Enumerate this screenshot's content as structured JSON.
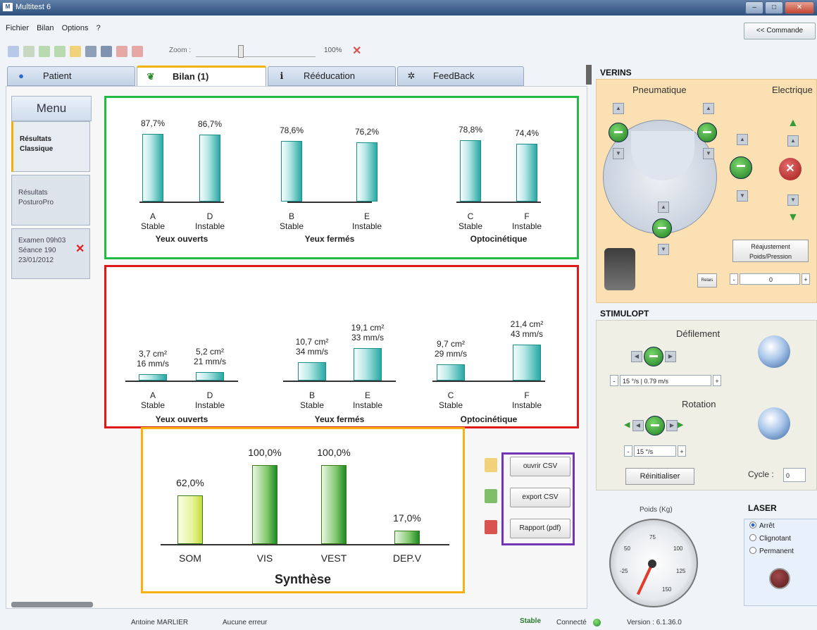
{
  "window": {
    "title": "Multitest 6"
  },
  "menubar": {
    "items": [
      "Fichier",
      "Bilan",
      "Options",
      "?"
    ],
    "commande_btn": "<< Commande"
  },
  "toolbar": {
    "zoom_label": "Zoom :",
    "zoom_value": "100%"
  },
  "tabs": [
    {
      "label": "Patient"
    },
    {
      "label": "Bilan (1)"
    },
    {
      "label": "Rééducation"
    },
    {
      "label": "FeedBack"
    }
  ],
  "sidebar": {
    "menu_label": "Menu",
    "items": [
      {
        "line1": "Résultats",
        "line2": "Classique"
      },
      {
        "line1": "Résultats",
        "line2": "PosturoPro"
      },
      {
        "line1": "Examen 09h03",
        "line2": "Séance 190",
        "line3": "23/01/2012"
      }
    ]
  },
  "chart_top": {
    "groups": [
      "Yeux ouverts",
      "Yeux fermés",
      "Optocinétique"
    ],
    "bars": [
      {
        "letter": "A",
        "cond": "Stable",
        "value_label": "87,7%",
        "value": 87.7
      },
      {
        "letter": "D",
        "cond": "Instable",
        "value_label": "86,7%",
        "value": 86.7
      },
      {
        "letter": "B",
        "cond": "Stable",
        "value_label": "78,6%",
        "value": 78.6
      },
      {
        "letter": "E",
        "cond": "Instable",
        "value_label": "76,2%",
        "value": 76.2
      },
      {
        "letter": "C",
        "cond": "Stable",
        "value_label": "78,8%",
        "value": 78.8
      },
      {
        "letter": "F",
        "cond": "Instable",
        "value_label": "74,4%",
        "value": 74.4
      }
    ]
  },
  "chart_mid": {
    "groups": [
      "Yeux ouverts",
      "Yeux fermés",
      "Optocinétique"
    ],
    "bars": [
      {
        "letter": "A",
        "cond": "Stable",
        "l1": "3,7 cm²",
        "l2": "16 mm/s",
        "value": 3.7
      },
      {
        "letter": "D",
        "cond": "Instable",
        "l1": "5,2 cm²",
        "l2": "21 mm/s",
        "value": 5.2
      },
      {
        "letter": "B",
        "cond": "Stable",
        "l1": "10,7 cm²",
        "l2": "34 mm/s",
        "value": 10.7
      },
      {
        "letter": "E",
        "cond": "Instable",
        "l1": "19,1 cm²",
        "l2": "33 mm/s",
        "value": 19.1
      },
      {
        "letter": "C",
        "cond": "Stable",
        "l1": "9,7 cm²",
        "l2": "29 mm/s",
        "value": 9.7
      },
      {
        "letter": "F",
        "cond": "Instable",
        "l1": "21,4 cm²",
        "l2": "43 mm/s",
        "value": 21.4
      }
    ]
  },
  "chart_data": {
    "type": "bar",
    "title": "Synthèse",
    "categories": [
      "SOM",
      "VIS",
      "VEST",
      "DEP.V"
    ],
    "values": [
      62.0,
      100.0,
      100.0,
      17.0
    ],
    "value_labels": [
      "62,0%",
      "100,0%",
      "100,0%",
      "17,0%"
    ],
    "ylim": [
      0,
      100
    ]
  },
  "csv": {
    "open": "ouvrir CSV",
    "export": "export CSV",
    "report": "Rapport (pdf)"
  },
  "verins": {
    "title": "VERINS",
    "pneumatique": "Pneumatique",
    "electrique": "Electrique",
    "relais": "Relais",
    "reajustement1": "Réajustement",
    "reajustement2": "Poids/Pression",
    "combo_value": "0"
  },
  "stimulopt": {
    "title": "STIMULOPT",
    "defilement": "Défilement",
    "defil_combo": "15 °/s  |  0.79 m/s",
    "rotation": "Rotation",
    "rot_combo": "15 °/s",
    "reset": "Réinitialiser",
    "cycle_label": "Cycle :",
    "cycle_value": "0"
  },
  "gauge": {
    "title": "Poids (Kg)",
    "ticks": [
      "-25",
      "50",
      "75",
      "100",
      "125",
      "150"
    ]
  },
  "laser": {
    "title": "LASER",
    "options": [
      "Arrêt",
      "Clignotant",
      "Permanent"
    ],
    "selected": "Arrêt"
  },
  "status": {
    "user": "Antoine MARLIER",
    "errors": "Aucune erreur",
    "stable": "Stable",
    "connected": "Connecté",
    "version": "Version : 6.1.36.0"
  }
}
